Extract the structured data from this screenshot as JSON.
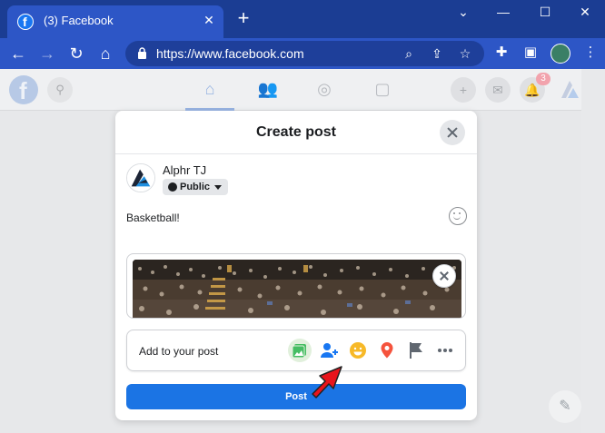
{
  "browser": {
    "tab_title": "(3) Facebook",
    "url": "https://www.facebook.com",
    "tab_close_icon": "close-icon",
    "new_tab_icon": "plus-icon",
    "window_controls": [
      "chevron-down-icon",
      "minimize-icon",
      "maximize-icon",
      "close-icon"
    ]
  },
  "facebook": {
    "notification_count": "3",
    "active_nav": "home"
  },
  "modal": {
    "title": "Create post",
    "author": {
      "name": "Alphr TJ",
      "privacy": "Public"
    },
    "post_text": "Basketball!",
    "add_to_post_label": "Add to your post",
    "post_button_label": "Post"
  },
  "colors": {
    "chrome_dark": "#1b3d93",
    "chrome": "#2d56c6",
    "facebook_blue": "#1b74e4",
    "arrow_red": "#e8141c"
  }
}
